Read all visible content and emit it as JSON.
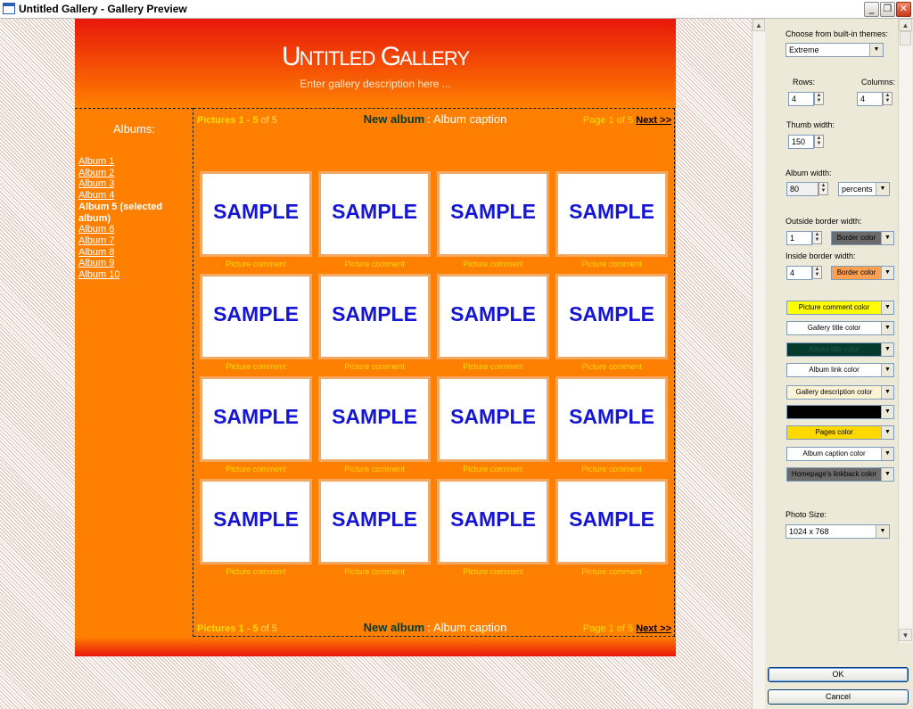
{
  "window": {
    "title": "Untitled Gallery - Gallery Preview",
    "buttons": {
      "minimize": "_",
      "restore": "❐",
      "close": "✕"
    }
  },
  "gallery": {
    "title_first_letter_1": "U",
    "title_rest_1": "NTITLED",
    "title_first_letter_2": "G",
    "title_rest_2": "ALLERY",
    "description": "Enter gallery description here ...",
    "albums_heading": "Albums:",
    "albums": [
      {
        "label": "Album 1"
      },
      {
        "label": "Album 2"
      },
      {
        "label": "Album 3"
      },
      {
        "label": "Album 4"
      },
      {
        "label": "Album 5 (selected album)",
        "selected": true
      },
      {
        "label": "Album 6"
      },
      {
        "label": "Album 7"
      },
      {
        "label": "Album 8"
      },
      {
        "label": "Album 9"
      },
      {
        "label": "Album 10"
      }
    ],
    "nav": {
      "pictures_prefix": "Pictures 1 - 5",
      "pictures_of": " of 5",
      "album_name": "New album",
      "separator": ":",
      "album_caption": "Album caption",
      "page_text": "Page 1 of 5",
      "next_label": "Next >>"
    },
    "thumb_text": "SAMPLE",
    "comment_text": "Picture comment",
    "grid": {
      "rows": 4,
      "cols": 4
    }
  },
  "settings": {
    "themes_label": "Choose from built-in themes:",
    "theme_value": "Extreme",
    "rows_label": "Rows:",
    "rows_value": "4",
    "columns_label": "Columns:",
    "columns_value": "4",
    "thumb_width_label": "Thumb width:",
    "thumb_width_value": "150",
    "album_width_label": "Album width:",
    "album_width_value": "80",
    "album_width_unit": "percents",
    "outside_border_label": "Outside border width:",
    "outside_border_value": "1",
    "outside_border_color": "Border color",
    "inside_border_label": "Inside border width:",
    "inside_border_value": "4",
    "inside_border_color": "Border color",
    "color_pickers": [
      {
        "label": "Picture comment color",
        "bg": "#ffff00",
        "fg": "#000000"
      },
      {
        "label": "Gallery title color",
        "bg": "#ffffff",
        "fg": "#000000"
      },
      {
        "label": "Album title color",
        "bg": "#063a2c",
        "fg": "#1f5a4a"
      },
      {
        "label": "Album link color",
        "bg": "#ffffff",
        "fg": "#000000"
      },
      {
        "label": "Gallery description color",
        "bg": "#fff3d6",
        "fg": "#000000"
      },
      {
        "label": "",
        "bg": "#000000",
        "fg": "#000000"
      },
      {
        "label": "Pages color",
        "bg": "#ffd800",
        "fg": "#000000"
      },
      {
        "label": "Album caption color",
        "bg": "#ffffff",
        "fg": "#000000"
      },
      {
        "label": "Homepage's linkback color",
        "bg": "#6b6b6b",
        "fg": "#000000"
      }
    ],
    "photo_size_label": "Photo Size:",
    "photo_size_value": "1024 x 768",
    "ok_label": "OK",
    "cancel_label": "Cancel"
  },
  "colors": {
    "gallery_bg": "#ff8000",
    "header_top": "#e8170b",
    "thumb_border": "#f2a860",
    "sample_text": "#1515d4",
    "pages_yellow": "#ffd800"
  }
}
